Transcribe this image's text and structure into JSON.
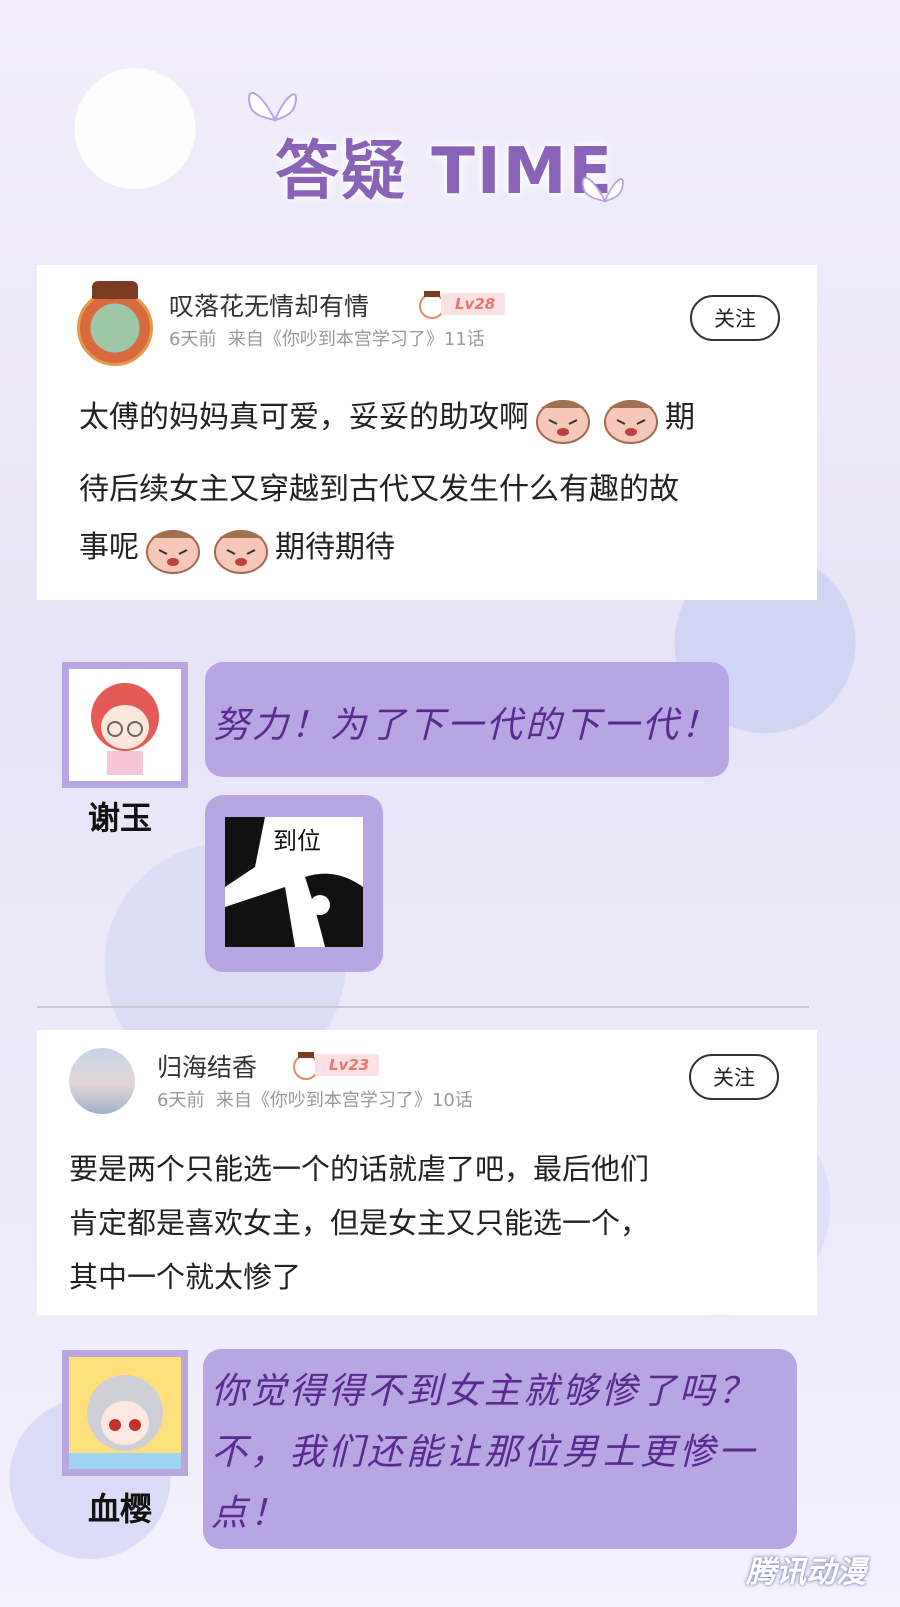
{
  "header": {
    "title": "答疑 TIME"
  },
  "comments": [
    {
      "username": "叹落花无情却有情",
      "level": "Lv28",
      "meta": "6天前  来自《你吵到本宫学习了》11话",
      "follow_label": "关注",
      "lines": [
        "太傅的妈妈真可爱，妥妥的助攻啊",
        "期",
        "待后续女主又穿越到古代又发生什么有趣的故",
        "事呢",
        "期待期待"
      ]
    },
    {
      "username": "归海结香",
      "level": "Lv23",
      "meta": "6天前  来自《你吵到本宫学习了》10话",
      "follow_label": "关注",
      "lines": [
        "要是两个只能选一个的话就虐了吧，最后他们",
        "肯定都是喜欢女主，但是女主又只能选一个，",
        "其中一个就太惨了"
      ]
    }
  ],
  "replies": [
    {
      "name": "谢玉",
      "text": "努力！为了下一代的下一代！",
      "sticker_text": "到位"
    },
    {
      "name": "血樱",
      "lines": [
        "你觉得得不到女主就够惨了吗？",
        "不，我们还能让那位男士更惨一",
        "点！"
      ]
    }
  ],
  "watermark": "腾讯动漫",
  "icons": [
    "butterfly-icon",
    "level-bear-icon",
    "laughing-emoji-icon"
  ],
  "colors": {
    "title": "#8a62b8",
    "bubble": "#b8a6e3",
    "bubble_text": "#5b2a8f",
    "level_tag": "#e8766f"
  }
}
